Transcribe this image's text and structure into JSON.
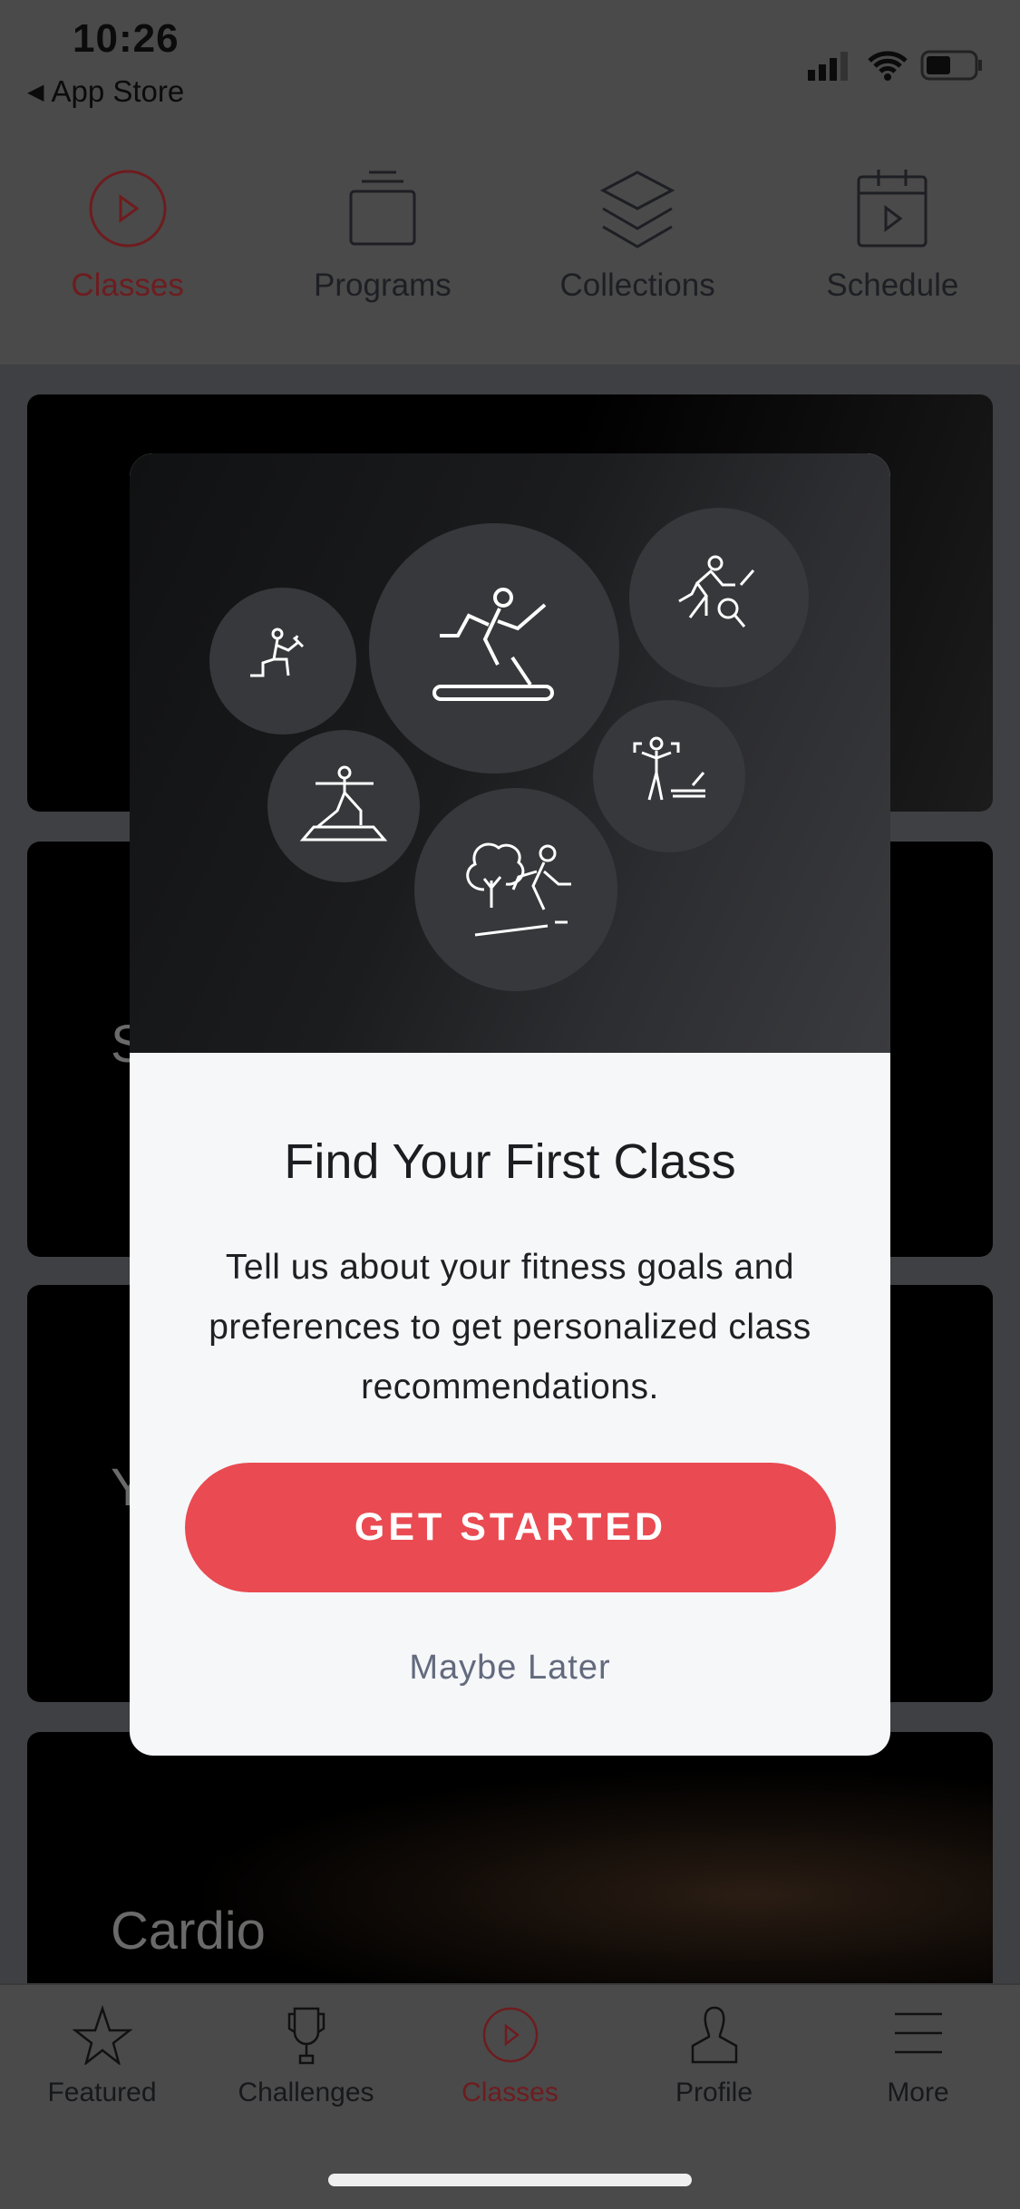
{
  "status_bar": {
    "time": "10:26",
    "back_label": "App Store"
  },
  "top_tabs": [
    {
      "label": "Classes",
      "icon": "play-circle-icon",
      "active": true
    },
    {
      "label": "Programs",
      "icon": "stack-icon"
    },
    {
      "label": "Collections",
      "icon": "layers-icon"
    },
    {
      "label": "Schedule",
      "icon": "calendar-play-icon"
    }
  ],
  "cards": [
    {
      "title": ""
    },
    {
      "title": "S"
    },
    {
      "title": "Y"
    },
    {
      "title": "Cardio"
    }
  ],
  "modal": {
    "icons": [
      "strength-icon",
      "tread-icon",
      "bike-icon",
      "yoga-icon",
      "row-strength-icon",
      "outdoor-icon"
    ],
    "title": "Find Your First Class",
    "body": "Tell us about your fitness goals and preferences to get personalized class recommendations.",
    "cta": "GET STARTED",
    "secondary": "Maybe Later"
  },
  "bottom_tabs": [
    {
      "label": "Featured",
      "icon": "star-icon"
    },
    {
      "label": "Challenges",
      "icon": "trophy-icon"
    },
    {
      "label": "Classes",
      "icon": "play-circle-icon",
      "active": true
    },
    {
      "label": "Profile",
      "icon": "person-icon"
    },
    {
      "label": "More",
      "icon": "menu-icon"
    }
  ],
  "colors": {
    "accent": "#ea4a51",
    "active_dimmed": "#6e1c1f",
    "overlay_bg": "#4a4a4a"
  }
}
